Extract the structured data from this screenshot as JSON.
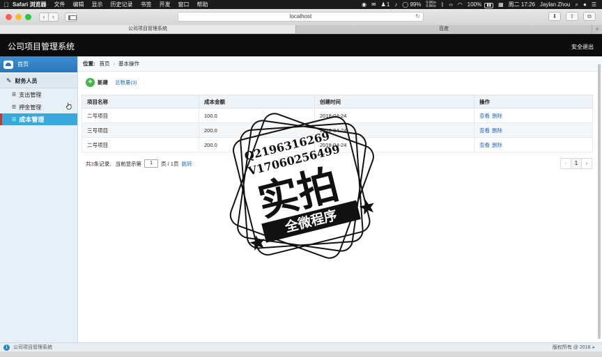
{
  "menubar": {
    "app": "Safari 浏览器",
    "menus": [
      "文件",
      "编辑",
      "显示",
      "历史记录",
      "书签",
      "开发",
      "窗口",
      "帮助"
    ],
    "status_count": "1",
    "net_up": "0.0K/s",
    "net_down": "0.5K/s",
    "cpu": "99%",
    "battery": "100%",
    "datetime": "周二 17:26",
    "user": "Jaylan Zhou"
  },
  "browser": {
    "address": "localhost",
    "tabs": [
      {
        "label": "公司项目管理系统",
        "active": true
      },
      {
        "label": "百度",
        "active": false
      }
    ]
  },
  "app": {
    "title": "公司项目管理系统",
    "logout": "安全退出"
  },
  "sidebar": {
    "home": "首页",
    "group": "财务人员",
    "items": [
      "支出管理",
      "押金管理",
      "成本管理"
    ],
    "active_index": 2
  },
  "breadcrumb": {
    "label": "位置:",
    "home": "首页",
    "current": "基本操作"
  },
  "actions": {
    "new_label": "新建",
    "total_label": "总数量(3)"
  },
  "table": {
    "headers": [
      "项目名称",
      "成本金额",
      "创建时间",
      "操作"
    ],
    "rows": [
      {
        "name": "二号项目",
        "amount": "100.0",
        "date": "2018-04-24"
      },
      {
        "name": "三号项目",
        "amount": "200.0",
        "date": "2018-04-24"
      },
      {
        "name": "二号项目",
        "amount": "200.0",
        "date": "2018-04-24"
      }
    ],
    "view_label": "查看",
    "delete_label": "删除"
  },
  "pager": {
    "prefix": "共",
    "count": "3",
    "suffix": "条记录,   当前显示第",
    "page": "1",
    "page_of": "页 / 1页",
    "jump": "跳转",
    "current": "1"
  },
  "footer": {
    "left": "公司项目管理系统",
    "right": "版权所有 @ 2018"
  },
  "watermark": {
    "line1": "Q2196316269",
    "line2": "V17060256499",
    "main": "实拍",
    "band": "全微程序"
  }
}
